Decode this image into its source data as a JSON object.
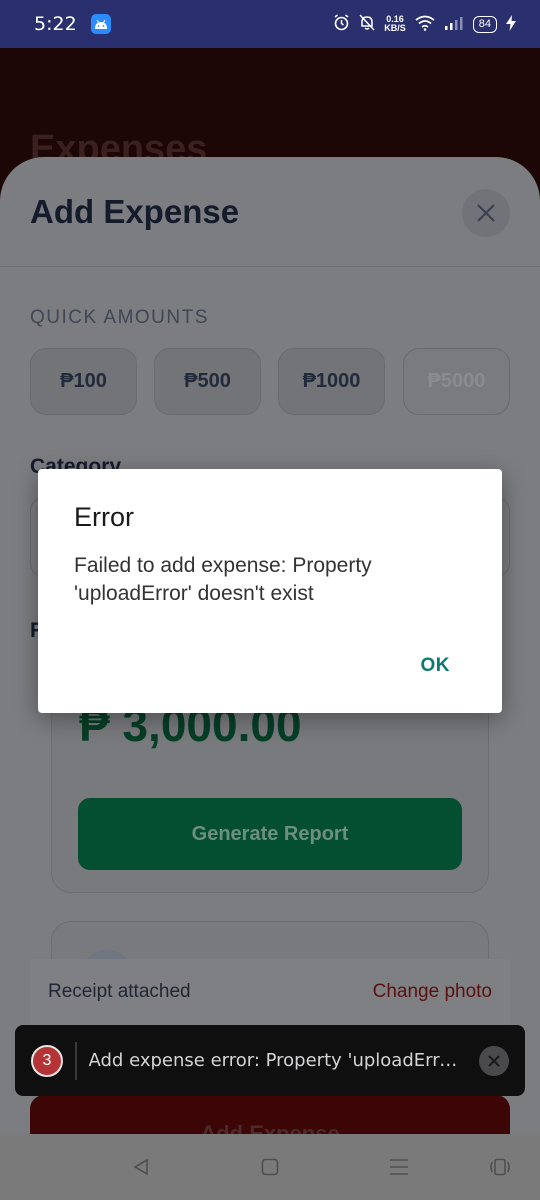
{
  "status_bar": {
    "time": "5:22",
    "net_speed_value": "0.16",
    "net_speed_unit": "KB/S",
    "battery": "84"
  },
  "background": {
    "title": "Expenses"
  },
  "sheet": {
    "title": "Add Expense",
    "quick_amounts_label": "QUICK AMOUNTS",
    "quick_amounts": [
      "₱100",
      "₱500",
      "₱1000",
      "₱5000"
    ],
    "category_label": "Category",
    "report_label_initial": "R",
    "report_amount": "₱ 3,000.00",
    "generate_report_label": "Generate Report",
    "receipt_status": "Receipt attached",
    "change_photo_label": "Change photo",
    "add_button_label": "Add Expense"
  },
  "dialog": {
    "title": "Error",
    "message": "Failed to add expense: Property 'uploadError' doesn't exist",
    "ok_label": "OK"
  },
  "toast": {
    "count": "3",
    "message": "Add expense error: Property 'uploadError' doesn't exist"
  },
  "icons": {
    "close": "close-icon",
    "back": "back-icon",
    "home": "home-icon",
    "menu": "menu-icon",
    "accessibility": "accessibility-icon"
  },
  "colors": {
    "status_bar": "#2a2f6e",
    "accent_green": "#0b7a6f",
    "generate_button": "#044e31",
    "toast_badge": "#b43436"
  }
}
